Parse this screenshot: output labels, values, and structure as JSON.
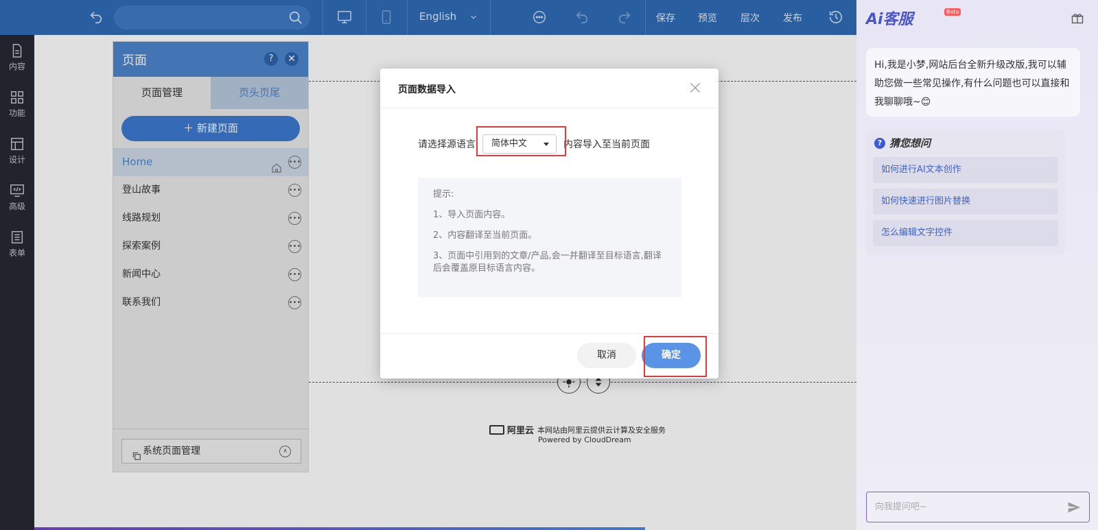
{
  "toolbar": {
    "language": "English",
    "save": "保存",
    "preview": "预览",
    "layers": "层次",
    "publish": "发布"
  },
  "leftnav": {
    "items": [
      {
        "label": "内容",
        "icon": "document-icon"
      },
      {
        "label": "功能",
        "icon": "grid-icon"
      },
      {
        "label": "设计",
        "icon": "layout-icon"
      },
      {
        "label": "高级",
        "icon": "code-icon"
      },
      {
        "label": "表单",
        "icon": "form-icon"
      }
    ]
  },
  "pagepanel": {
    "title": "页面",
    "help": "?",
    "close": "✕",
    "tabs": [
      "页面管理",
      "页头页尾"
    ],
    "new_page": "＋ 新建页面",
    "pages": [
      "Home",
      "登山故事",
      "线路规划",
      "探索案例",
      "新闻中心",
      "联系我们"
    ],
    "system": "系统页面管理"
  },
  "canvas": {
    "footer_logo": "阿里云",
    "footer_line1": "本网站由阿里云提供云计算及安全服务",
    "footer_line2": "Powered by CloudDream"
  },
  "dialog": {
    "title": "页面数据导入",
    "prefix": "请选择源语言",
    "selected_language": "简体中文",
    "suffix": "内容导入至当前页面",
    "tips_title": "提示:",
    "tips": [
      "1、导入页面内容。",
      "2、内容翻译至当前页面。",
      "3、页面中引用到的文章/产品,会一并翻译至目标语言,翻译后会覆盖原目标语言内容。"
    ],
    "cancel": "取消",
    "confirm": "确定"
  },
  "ai": {
    "logo": "Ai客服",
    "beta": "Beta",
    "greeting": "Hi,我是小梦,网站后台全新升级改版,我可以辅助您做一些常见操作,有什么问题也可以直接和我聊聊哦~😊",
    "faq_title": "猜您想问",
    "faq": [
      "如何进行AI文本创作",
      "如何快速进行图片替换",
      "怎么编辑文字控件"
    ],
    "input_placeholder": "向我提问吧~"
  },
  "colors": {
    "toolbar": "#2f6db8",
    "accent": "#4d86cf",
    "highlight": "#e03a3a",
    "confirm": "#5b93e6"
  }
}
